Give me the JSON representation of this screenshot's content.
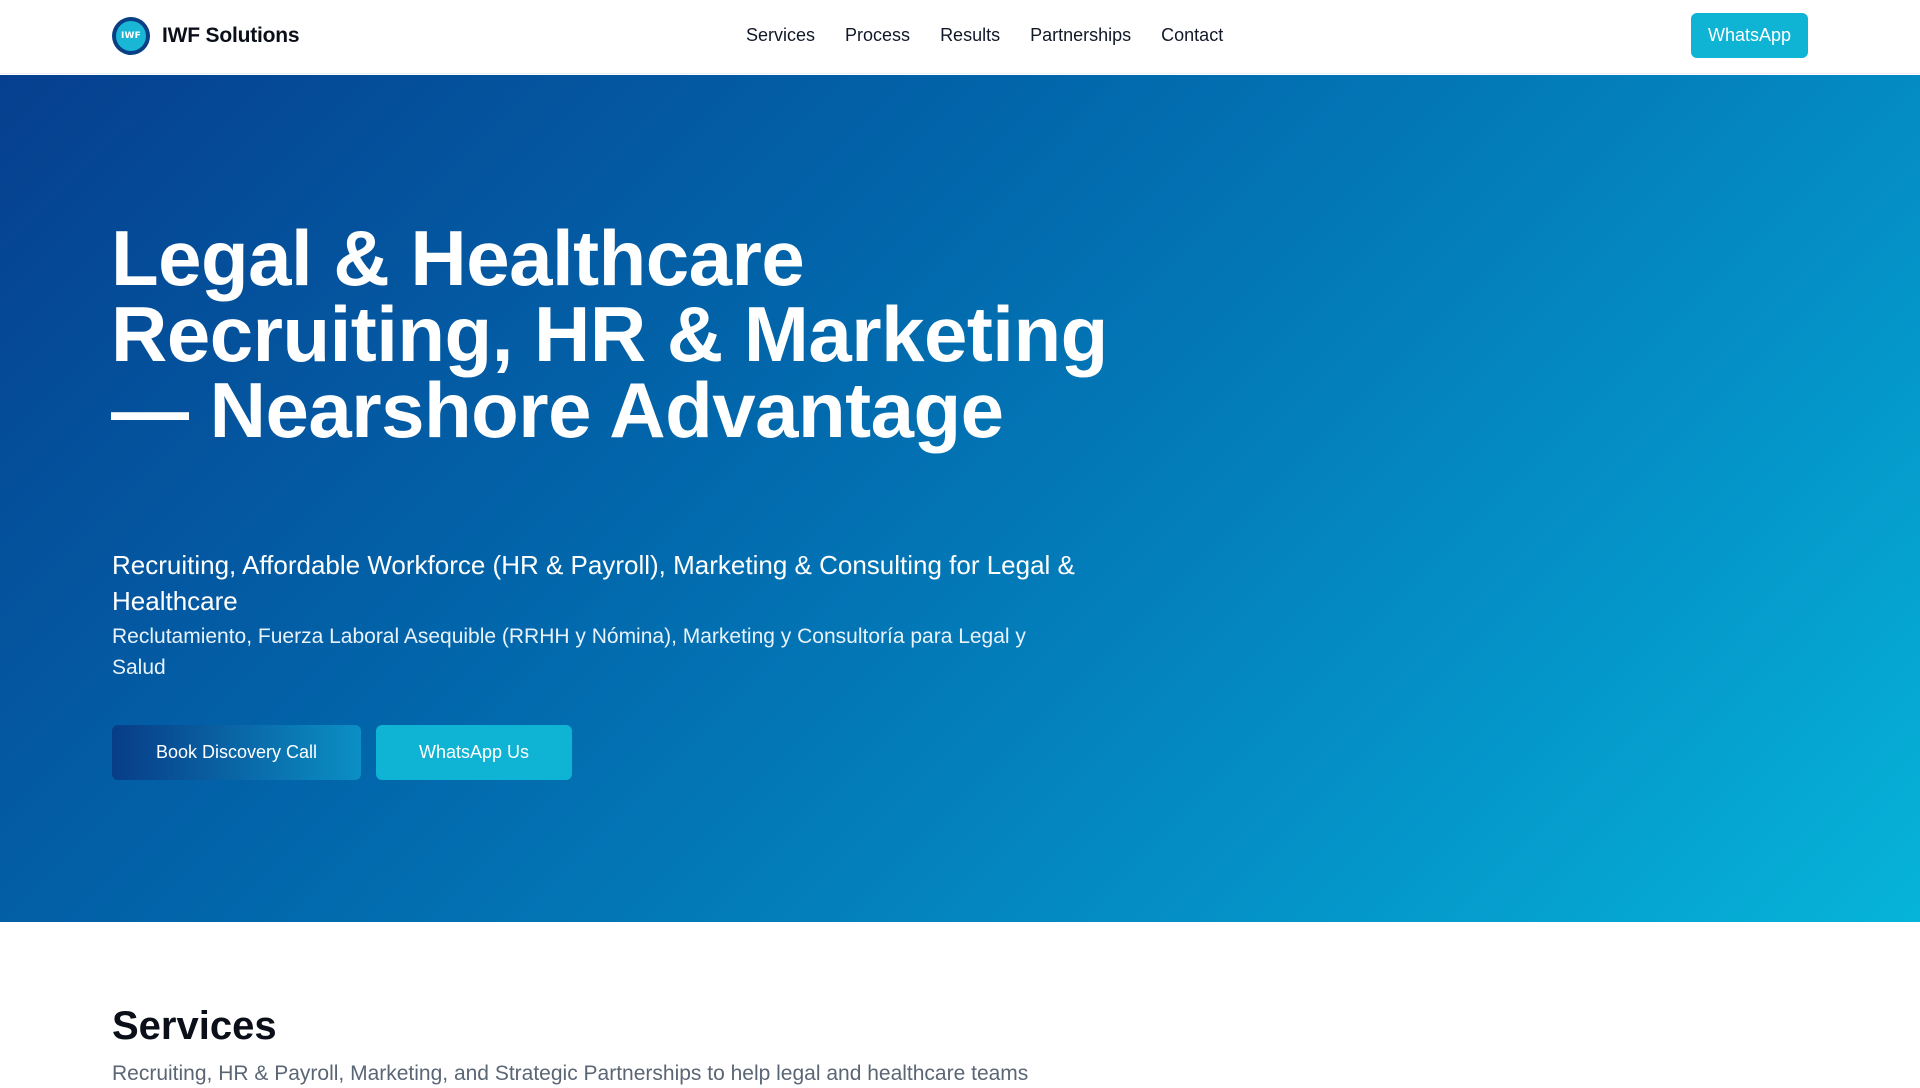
{
  "header": {
    "brand_logo_text": "IWF",
    "brand_name": "IWF Solutions",
    "nav": [
      {
        "label": "Services"
      },
      {
        "label": "Process"
      },
      {
        "label": "Results"
      },
      {
        "label": "Partnerships"
      },
      {
        "label": "Contact"
      }
    ],
    "cta_label": "WhatsApp"
  },
  "hero": {
    "title": "Legal & Healthcare Recruiting, HR & Marketing — Nearshore Advantage",
    "subtitle_en": "Recruiting, Affordable Workforce (HR & Payroll), Marketing & Consulting for Legal & Healthcare",
    "subtitle_es": "Reclutamiento, Fuerza Laboral Asequible (RRHH y Nómina), Marketing y Consultoría para Legal y Salud",
    "primary_button": "Book Discovery Call",
    "secondary_button": "WhatsApp Us"
  },
  "services": {
    "title": "Services",
    "lead": "Recruiting, HR & Payroll, Marketing, and Strategic Partnerships to help legal and healthcare teams"
  },
  "colors": {
    "accent": "#0fb3d3",
    "hero_start": "#063f8f",
    "hero_end": "#06b4d9",
    "text_dark": "#0b0f19",
    "text_muted": "#5b6675"
  },
  "icons": {
    "brand_logo": "iwf-logo-icon"
  }
}
